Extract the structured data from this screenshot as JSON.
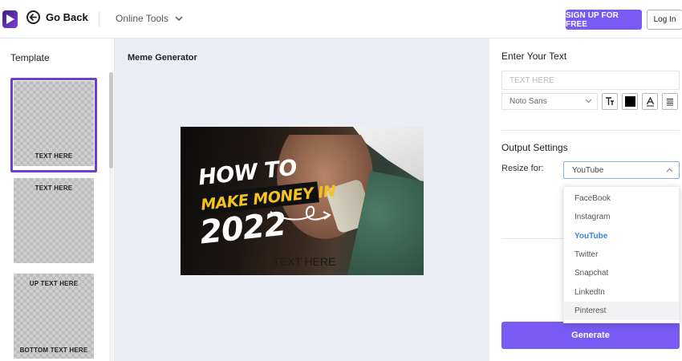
{
  "header": {
    "back_label": "Go Back",
    "online_tools_label": "Online Tools",
    "signup_label": "SIGN UP FOR FREE",
    "login_label": "Log In",
    "accent_color": "#7a5af5"
  },
  "left_panel": {
    "title": "Template",
    "templates": [
      {
        "top_text": "",
        "bottom_text": "TEXT HERE",
        "selected": true
      },
      {
        "top_text": "TEXT HERE",
        "bottom_text": "",
        "selected": false
      },
      {
        "top_text": "UP TEXT HERE",
        "bottom_text": "BOTTOM TEXT HERE",
        "selected": false
      }
    ]
  },
  "canvas": {
    "title": "Meme Generator",
    "image_text": {
      "line1": "HOW TO",
      "line2": "MAKE MONEY IN",
      "line3": "2022"
    },
    "overlay_text": "TEXT HERE"
  },
  "right_panel": {
    "enter_text_title": "Enter Your Text",
    "text_placeholder": "TEXT HERE",
    "font_value": "Noto Sans",
    "format_icons": [
      "text-size-icon",
      "color-swatch-icon",
      "text-style-icon",
      "align-icon"
    ],
    "swatch_color": "#000000",
    "output_title": "Output Settings",
    "resize_label": "Resize for:",
    "resize_value": "YouTube",
    "resize_options": [
      "FaceBook",
      "Instagram",
      "YouTube",
      "Twitter",
      "Snapchat",
      "LinkedIn",
      "Pinterest"
    ],
    "generate_label": "Generate"
  }
}
